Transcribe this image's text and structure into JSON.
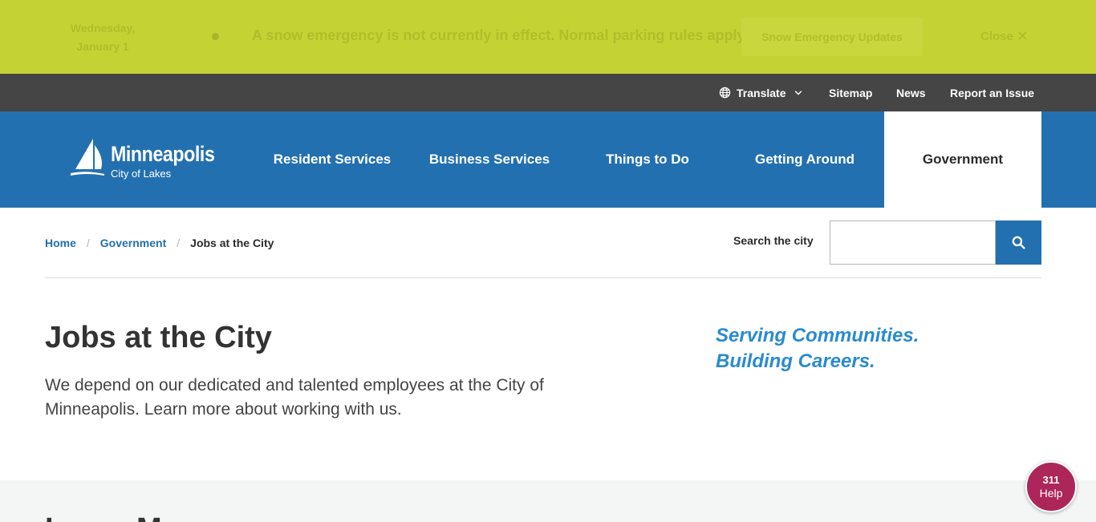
{
  "alert": {
    "date": "Wednesday, January 1",
    "message": "A snow emergency is not currently in effect. Normal parking rules apply.",
    "button_label": "Snow Emergency Updates",
    "close_label": "Close"
  },
  "utility": {
    "translate_label": "Translate",
    "sitemap_label": "Sitemap",
    "news_label": "News",
    "report_label": "Report an Issue"
  },
  "logo": {
    "name": "Minneapolis",
    "tagline": "City of Lakes"
  },
  "nav": {
    "resident": "Resident Services",
    "business": "Business Services",
    "things": "Things to Do",
    "getting_around": "Getting Around",
    "government": "Government"
  },
  "breadcrumb": {
    "home": "Home",
    "government": "Government",
    "current": "Jobs at the City",
    "separator": "/"
  },
  "search": {
    "label": "Search the city",
    "value": ""
  },
  "hero": {
    "title": "Jobs at the City",
    "intro": "We depend on our dedicated and talented employees at the City of Minneapolis. Learn more about working with us.",
    "tagline_line1": "Serving Communities.",
    "tagline_line2": "Building Careers."
  },
  "lower": {
    "heading": "Learn More"
  },
  "help": {
    "number": "311",
    "word": "Help"
  },
  "colors": {
    "alert_bg": "#c5d234",
    "utility_bg": "#454545",
    "nav_bg": "#2370b0",
    "tagline": "#2a8bcf",
    "help_bg": "#ad2659"
  }
}
